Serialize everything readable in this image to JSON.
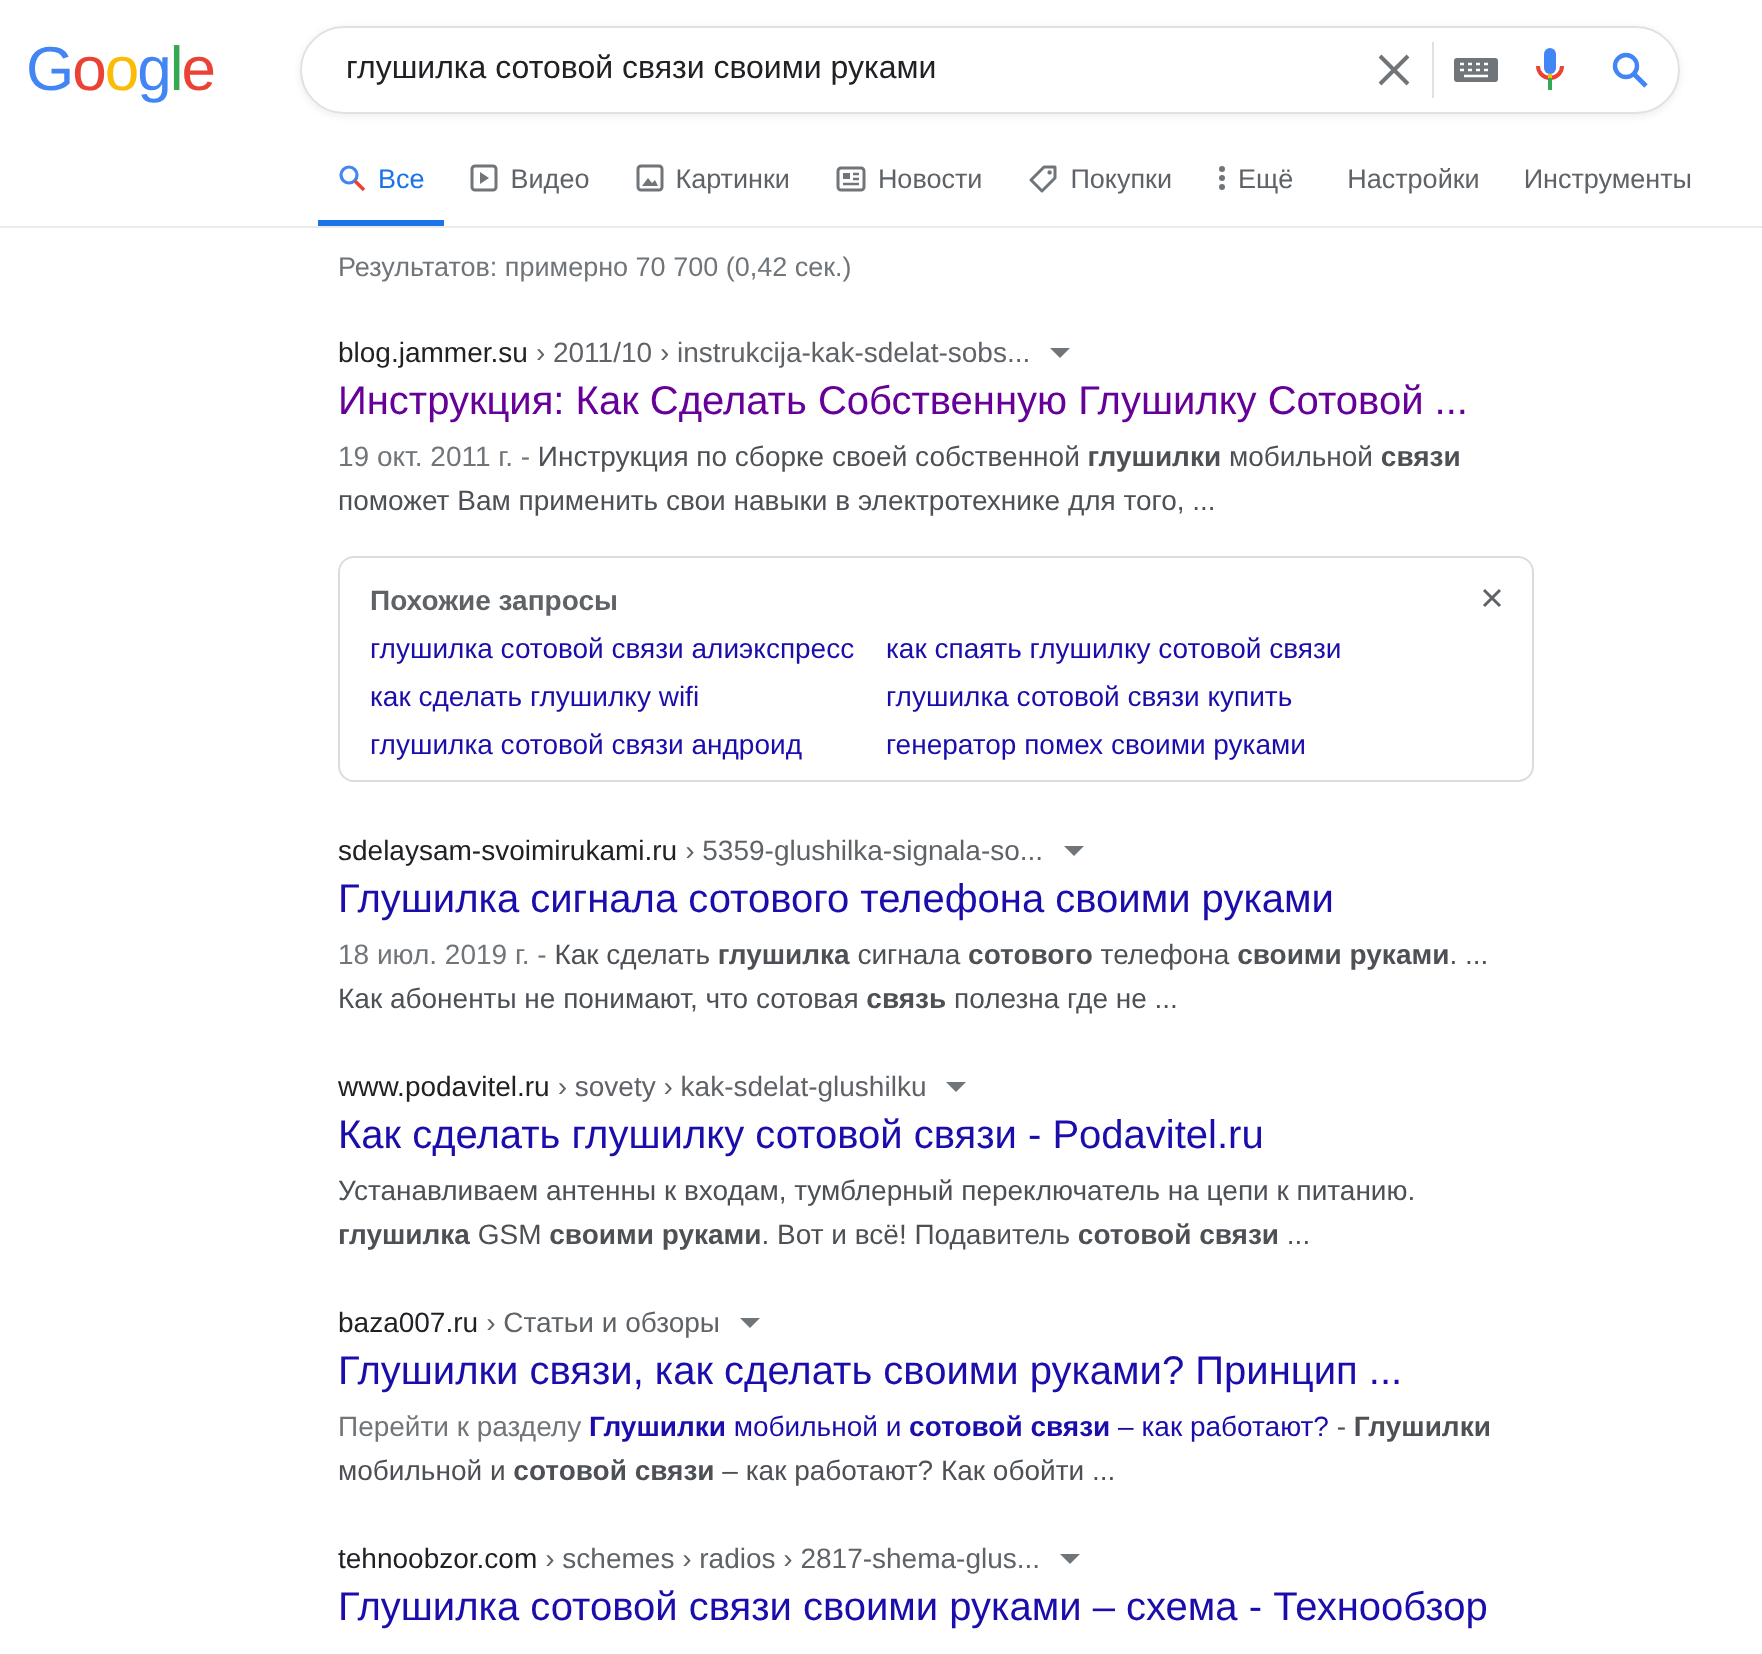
{
  "logo": "Google",
  "search": {
    "value": "глушилка сотовой связи своими руками"
  },
  "tabs": [
    {
      "label": "Все",
      "selected": true
    },
    {
      "label": "Видео",
      "selected": false
    },
    {
      "label": "Картинки",
      "selected": false
    },
    {
      "label": "Новости",
      "selected": false
    },
    {
      "label": "Покупки",
      "selected": false
    },
    {
      "label": "Ещё",
      "selected": false
    }
  ],
  "tools": [
    "Настройки",
    "Инструменты"
  ],
  "result_stats": "Результатов: примерно 70 700 (0,42 сек.)",
  "results": [
    {
      "site": "blog.jammer.su",
      "path": "› 2011/10 › instrukcija-kak-sdelat-sobs...",
      "title": "Инструкция: Как Сделать Собственную Глушилку Сотовой ...",
      "visited": true,
      "date": "19 окт. 2011 г. - ",
      "snippet": "Инструкция по сборке своей собственной **глушилки** мобильной **связи** поможет Вам применить свои навыки в электротехнике для того, ..."
    },
    {
      "site": "sdelaysam-svoimirukami.ru",
      "path": "› 5359-glushilka-signala-so...",
      "title": "Глушилка сигнала сотового телефона своими руками",
      "visited": false,
      "date": "18 июл. 2019 г. - ",
      "snippet": "Как сделать **глушилка** сигнала **сотового** телефона **своими руками**. ... Как абоненты не понимают, что сотовая **связь** полезна где не ..."
    },
    {
      "site": "www.podavitel.ru",
      "path": "› sovety › kak-sdelat-glushilku",
      "title": "Как сделать глушилку сотовой связи - Podavitel.ru",
      "visited": false,
      "snippet": "Устанавливаем антенны к входам, тумблерный переключатель на цепи к питанию. **глушилка** GSM **своими руками**. Вот и всё! Подавитель **сотовой связи** ..."
    },
    {
      "site": "baza007.ru",
      "path": "› Статьи и обзоры",
      "title": "Глушилки связи, как сделать своими руками? Принцип ...",
      "visited": false,
      "jump_prefix": "Перейти к разделу ",
      "jump_link": "**Глушилки** мобильной и **сотовой связи** – как работают?",
      "snippet": " - **Глушилки** мобильной и **сотовой связи** – как работают? Как обойти ..."
    },
    {
      "site": "tehnoobzor.com",
      "path": "› schemes › radios › 2817-shema-glus...",
      "title": "Глушилка сотовой связи своими руками – схема - Технообзор",
      "visited": false
    }
  ],
  "related": {
    "heading": "Похожие запросы",
    "queries": [
      "глушилка сотовой связи алиэкспресс",
      "как спаять глушилку сотовой связи",
      "как сделать глушилку wifi",
      "глушилка сотовой связи купить",
      "глушилка сотовой связи андроид",
      "генератор помех своими руками"
    ]
  }
}
